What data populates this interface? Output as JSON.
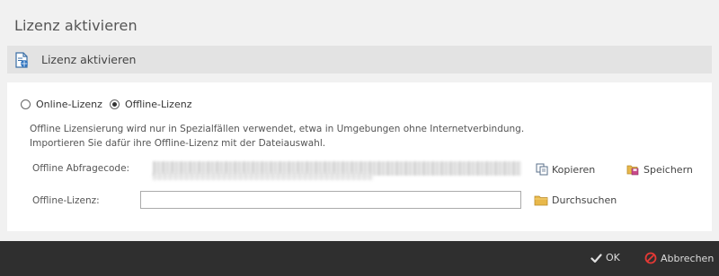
{
  "window": {
    "title": "Lizenz aktivieren"
  },
  "section": {
    "title": "Lizenz aktivieren",
    "icon": "license-document-icon"
  },
  "mode": {
    "options": [
      {
        "label": "Online-Lizenz",
        "checked": false
      },
      {
        "label": "Offline-Lizenz",
        "checked": true
      }
    ]
  },
  "description": {
    "line1": "Offline Lizensierung wird nur in Spezialfällen verwendet, etwa in Umgebungen ohne Internetverbindung.",
    "line2": "Importieren Sie dafür ihre Offline-Lizenz mit der Dateiauswahl."
  },
  "request_code": {
    "label": "Offline Abfragecode:",
    "copy_label": "Kopieren",
    "save_label": "Speichern"
  },
  "license_file": {
    "label": "Offline-Lizenz:",
    "value": "",
    "browse_label": "Durchsuchen"
  },
  "footer": {
    "ok_label": "OK",
    "cancel_label": "Abbrechen"
  },
  "colors": {
    "footer_bg": "#2f2f2f",
    "cancel_red": "#e53935",
    "folder_yellow": "#e8b84a"
  }
}
